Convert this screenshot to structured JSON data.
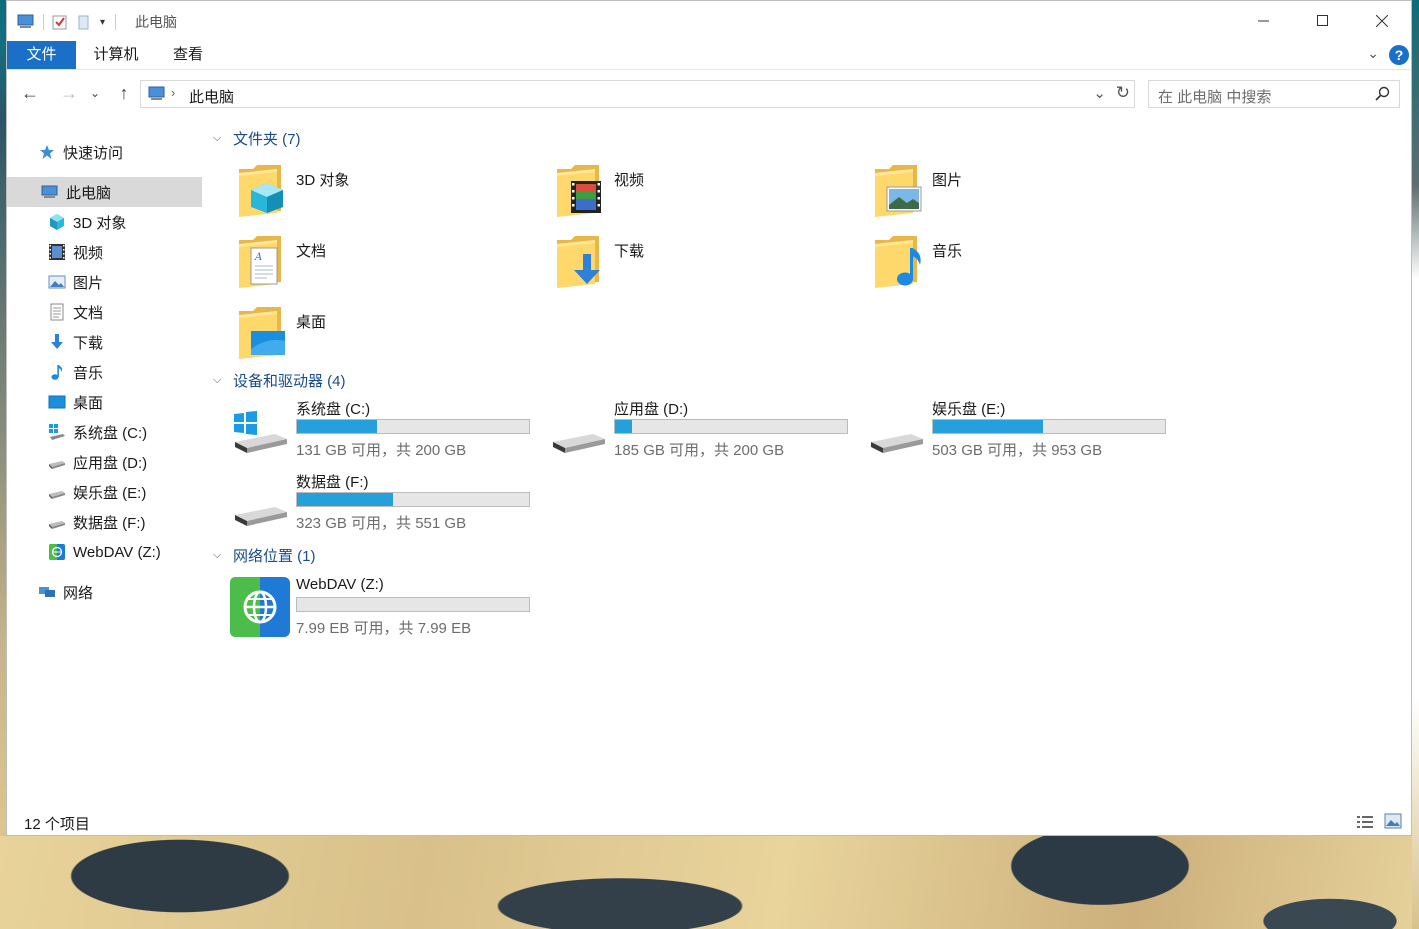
{
  "window": {
    "title": "此电脑"
  },
  "ribbon": {
    "tabs": [
      {
        "label": "文件"
      },
      {
        "label": "计算机"
      },
      {
        "label": "查看"
      }
    ],
    "help_label": "?"
  },
  "address": {
    "location": "此电脑"
  },
  "search": {
    "placeholder": "在 此电脑 中搜索"
  },
  "sidebar": {
    "quick_access": "快速访问",
    "this_pc": "此电脑",
    "items": [
      {
        "label": "3D 对象",
        "icon": "cube-3d-icon"
      },
      {
        "label": "视频",
        "icon": "video-icon"
      },
      {
        "label": "图片",
        "icon": "picture-icon"
      },
      {
        "label": "文档",
        "icon": "document-icon"
      },
      {
        "label": "下载",
        "icon": "download-icon"
      },
      {
        "label": "音乐",
        "icon": "music-icon"
      },
      {
        "label": "桌面",
        "icon": "desktop-icon"
      },
      {
        "label": "系统盘 (C:)",
        "icon": "windows-drive-icon"
      },
      {
        "label": "应用盘 (D:)",
        "icon": "drive-icon"
      },
      {
        "label": "娱乐盘 (E:)",
        "icon": "drive-icon"
      },
      {
        "label": "数据盘 (F:)",
        "icon": "drive-icon"
      },
      {
        "label": "WebDAV (Z:)",
        "icon": "webdav-icon"
      }
    ],
    "network": "网络"
  },
  "groups": {
    "folders": {
      "header": "文件夹 (7)",
      "items": [
        "3D 对象",
        "视频",
        "图片",
        "文档",
        "下载",
        "音乐",
        "桌面"
      ]
    },
    "drives": {
      "header": "设备和驱动器 (4)"
    },
    "network": {
      "header": "网络位置 (1)"
    }
  },
  "drives": [
    {
      "name": "系统盘 (C:)",
      "free": "131 GB 可用，共 200 GB",
      "used_fraction": 0.345
    },
    {
      "name": "应用盘 (D:)",
      "free": "185 GB 可用，共 200 GB",
      "used_fraction": 0.075
    },
    {
      "name": "娱乐盘 (E:)",
      "free": "503 GB 可用，共 953 GB",
      "used_fraction": 0.472
    },
    {
      "name": "数据盘 (F:)",
      "free": "323 GB 可用，共 551 GB",
      "used_fraction": 0.414
    }
  ],
  "network_location": {
    "name": "WebDAV (Z:)",
    "free": "7.99 EB 可用，共 7.99 EB",
    "used_fraction": 0.0
  },
  "status": {
    "item_count": "12 个项目"
  },
  "colors": {
    "accent": "#1a6fc7",
    "progress": "#26a0da",
    "header_text": "#1a4c8c"
  }
}
